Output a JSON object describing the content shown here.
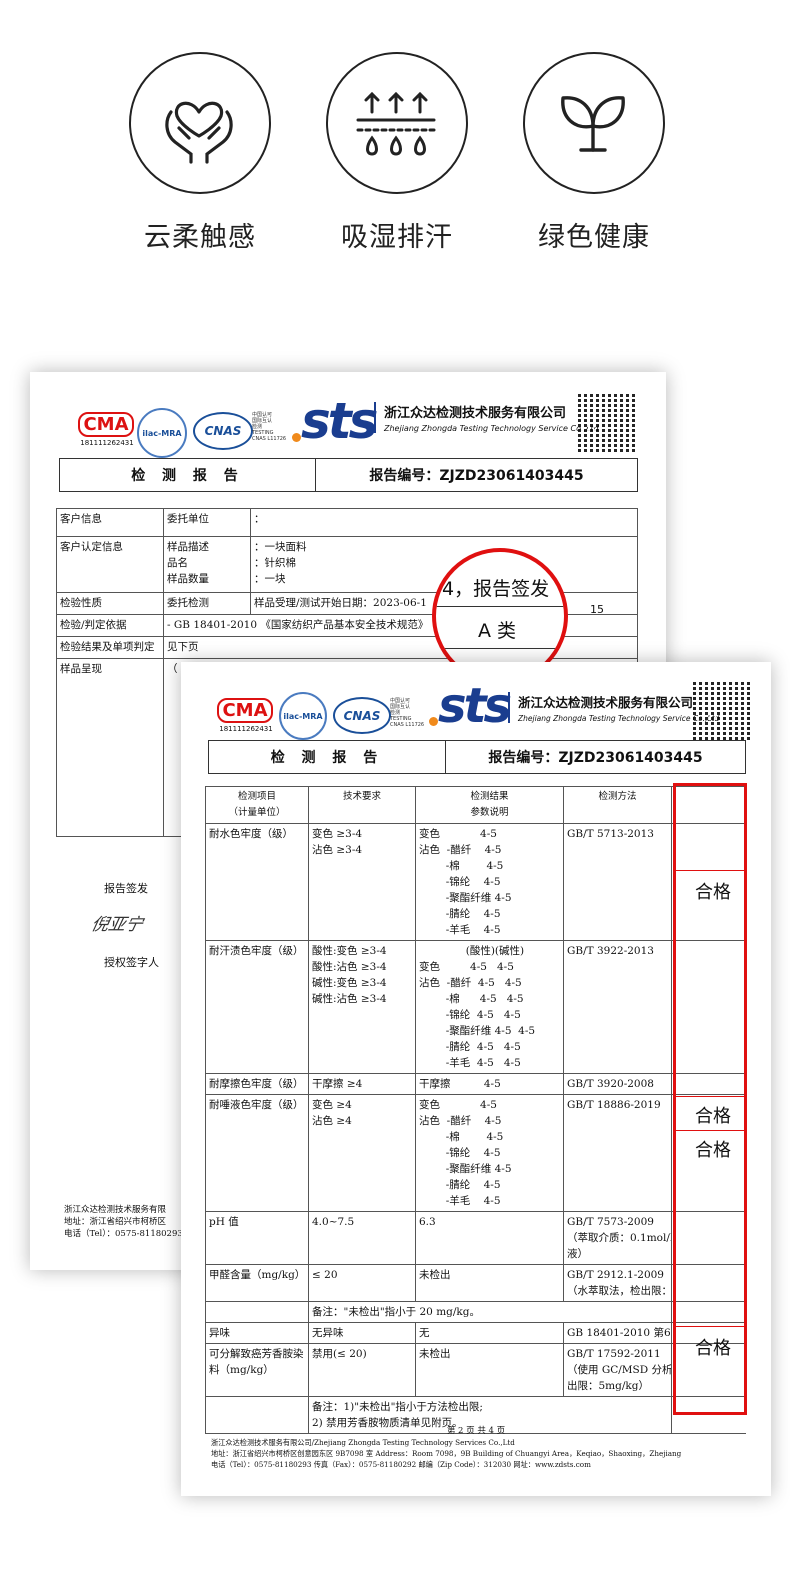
{
  "features": [
    {
      "icon": "heart-hands-icon",
      "label": "云柔触感"
    },
    {
      "icon": "moisture-wicking-icon",
      "label": "吸湿排汗"
    },
    {
      "icon": "sprout-icon",
      "label": "绿色健康"
    }
  ],
  "logos": {
    "cma_text": "CMA",
    "cma_number": "181111262431",
    "ilac": "ilac-MRA",
    "cnas": "CNAS",
    "cnas_small": "中国认可\n国际互认\n检测\nTESTING\nCNAS L11726",
    "sts": "sts"
  },
  "company": {
    "name_cn": "浙江众达检测技术服务有限公司",
    "name_en": "Zhejiang Zhongda Testing Technology Service Co.,Ltd"
  },
  "report": {
    "title": "检 测 报 告",
    "number_label": "报告编号：ZJZD23061403445"
  },
  "back_page": {
    "rows": [
      {
        "k": "客户信息",
        "a": "委托单位",
        "b": "："
      },
      {
        "k": "客户认定信息",
        "a": "样品描述\n品名\n样品数量",
        "b": "：一块面料\n：针织棉\n：一块"
      },
      {
        "k": "检验性质",
        "a": "委托检测",
        "b": "样品受理/测试开始日期：2023-06-1"
      },
      {
        "k": "检验/判定依据",
        "a": "- GB 18401-2010 《国家纺织产品基本安全技术规范》",
        "b": ""
      },
      {
        "k": "检验结果及单项判定",
        "a": "见下页",
        "b": ""
      },
      {
        "k": "样品呈现",
        "a": "（",
        "b": ""
      }
    ],
    "date_tail": "15",
    "sign_label": "报告签发",
    "sign_name": "倪亚宁",
    "authorized": "授权签字人",
    "footer_lines": [
      "浙江众达检测技术服务有限",
      "地址：浙江省绍兴市柯桥区",
      "电话（Tel）：0575-81180293"
    ]
  },
  "zoom": {
    "line1": "4，报告签发",
    "line2": "A 类"
  },
  "table": {
    "headers": [
      "检测项目\n（计量单位）",
      "技术要求",
      "检测结果\n参数说明",
      "检测方法"
    ],
    "rows": [
      {
        "item": "耐水色牢度（级）",
        "req": "变色 ≥3-4\n沾色 ≥3-4",
        "res": "变色            4-5\n沾色  -醋纤    4-5\n        -棉        4-5\n        -锦纶    4-5\n        -聚酯纤维 4-5\n        -腈纶    4-5\n        -羊毛    4-5",
        "method": "GB/T 5713-2013"
      },
      {
        "item": "耐汗渍色牢度（级）",
        "req": "酸性:变色 ≥3-4\n酸性:沾色 ≥3-4\n碱性:变色 ≥3-4\n碱性:沾色 ≥3-4",
        "res": "              (酸性)(碱性)\n变色         4-5   4-5\n沾色  -醋纤  4-5   4-5\n        -棉      4-5   4-5\n        -锦纶  4-5   4-5\n        -聚酯纤维 4-5  4-5\n        -腈纶  4-5   4-5\n        -羊毛  4-5   4-5",
        "method": "GB/T 3922-2013"
      },
      {
        "item": "耐摩擦色牢度（级）",
        "req": "干摩擦 ≥4",
        "res": "干摩擦          4-5",
        "method": "GB/T 3920-2008"
      },
      {
        "item": "耐唾液色牢度（级）",
        "req": "变色 ≥4\n沾色 ≥4",
        "res": "变色            4-5\n沾色  -醋纤    4-5\n        -棉        4-5\n        -锦纶    4-5\n        -聚酯纤维 4-5\n        -腈纶    4-5\n        -羊毛    4-5",
        "method": "GB/T 18886-2019"
      },
      {
        "item": "pH 值",
        "req": "4.0~7.5",
        "res": "6.3",
        "method": "GB/T 7573-2009\n（萃取介质：0.1mol/L 氯\n液）"
      },
      {
        "item": "甲醛含量（mg/kg）",
        "req": "≤ 20",
        "res": "未检出",
        "method": "GB/T 2912.1-2009\n（水萃取法，检出限：20"
      },
      {
        "item": "",
        "req": "备注：\"未检出\"指小于 20 mg/kg。",
        "res": "",
        "method": ""
      },
      {
        "item": "异味",
        "req": "无异味",
        "res": "无",
        "method": "GB 18401-2010 第6.7"
      },
      {
        "item": "可分解致癌芳香胺染料（mg/kg）",
        "req": "禁用(≤ 20)",
        "res": "未检出",
        "method": "GB/T 17592-2011\n（使用 GC/MSD 分析方\n出限：5mg/kg）"
      },
      {
        "item": "",
        "req": "备注：1)\"未检出\"指小于方法检出限;\n2) 禁用芳香胺物质清单见附页。",
        "res": "",
        "method": ""
      }
    ],
    "pass_label": "合格"
  },
  "front_footer": {
    "page": "第 2 页 共 4 页",
    "lines": [
      "浙江众达检测技术服务有限公司/Zhejiang Zhongda Testing Technology Services Co.,Ltd",
      "地址：浙江省绍兴市柯桥区创意园东区 9B7098 室     Address：Room 7098，9B Building of Chuangyi Area，Keqiao，Shaoxing，Zhejiang",
      "电话（Tel）：0575-81180293          传真（Fax）：0575-81180292          邮编（Zip Code）：312030          网址：www.zdsts.com"
    ]
  },
  "colors": {
    "accent_red": "#e01010",
    "sts_blue": "#1a3d8f",
    "sts_orange": "#f08a1c"
  }
}
